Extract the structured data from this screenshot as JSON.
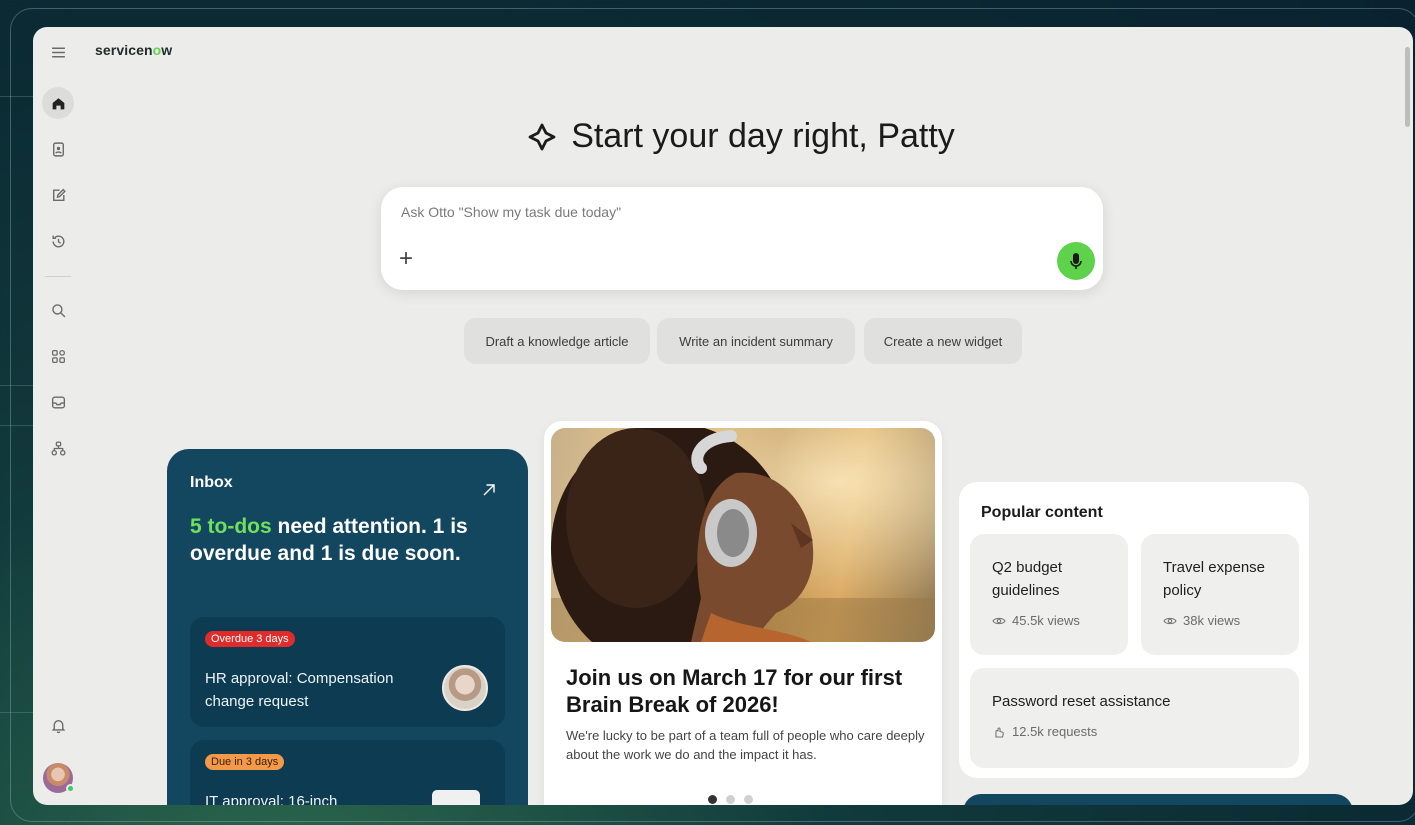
{
  "brand": {
    "name_prefix": "servicen",
    "name_o": "o",
    "name_suffix": "w",
    "accent": "#62d84e"
  },
  "sidebar": {
    "items": [
      {
        "icon": "menu-icon"
      },
      {
        "icon": "home-icon"
      },
      {
        "icon": "contact-card-icon"
      },
      {
        "icon": "edit-icon"
      },
      {
        "icon": "history-icon"
      },
      {
        "icon": "search-icon"
      },
      {
        "icon": "apps-grid-icon"
      },
      {
        "icon": "inbox-icon"
      },
      {
        "icon": "workflow-icon"
      },
      {
        "icon": "bell-icon"
      }
    ]
  },
  "hero": {
    "title": "Start your day right, Patty",
    "ask_label": "Ask Otto   \"Show my task due today\""
  },
  "suggestions": [
    "Draft a knowledge article",
    "Write an incident summary",
    "Create a new widget"
  ],
  "inbox": {
    "title": "Inbox",
    "highlight": "5 to-dos",
    "headline_rest": " need attention. 1 is overdue and 1 is due soon.",
    "tasks": [
      {
        "badge": "Overdue 3 days",
        "text": "HR approval: Compensation change request"
      },
      {
        "badge": "Due in 3 days",
        "text": "IT approval: 16-inch"
      }
    ],
    "colors": {
      "card": "#12475f",
      "highlight": "#6ee05a",
      "overdue": "#e02b2b",
      "due": "#f39a4a"
    }
  },
  "event": {
    "title": "Join us on March 17 for our first Brain Break of 2026!",
    "description": "We're lucky to be part of a team full of people who care deeply about the work we do and the impact it has."
  },
  "popular": {
    "title": "Popular content",
    "items": [
      {
        "name": "Q2 budget guidelines",
        "meta": "45.5k views",
        "icon": "eye-icon"
      },
      {
        "name": "Travel expense policy",
        "meta": "38k views",
        "icon": "eye-icon"
      },
      {
        "name": "Password reset assistance",
        "meta": "12.5k requests",
        "icon": "hand-icon"
      }
    ]
  }
}
